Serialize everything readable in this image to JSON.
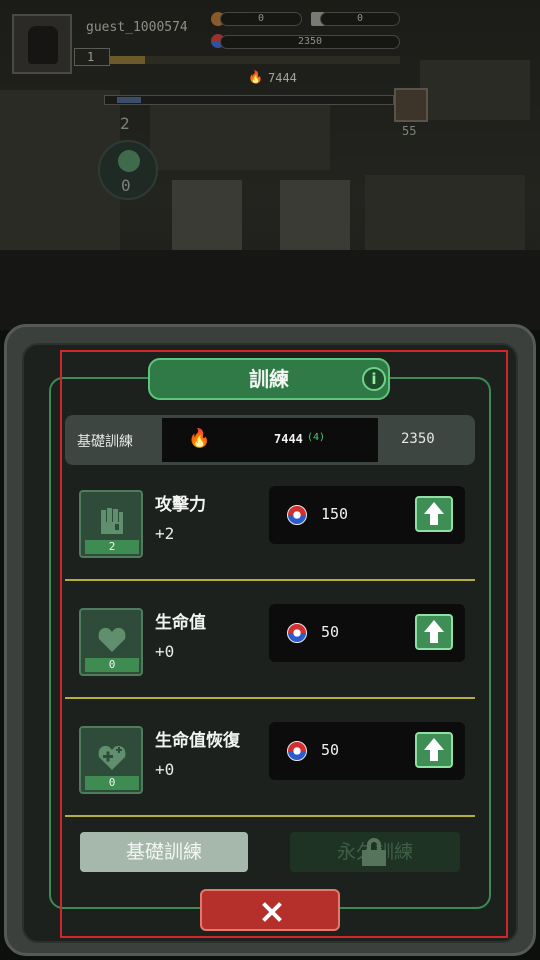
{
  "hud": {
    "player_name": "guest_1000574",
    "player_level": "1",
    "resource_a": "0",
    "resource_b": "0",
    "gold": "2350",
    "fire_power": "7444",
    "stage": "2",
    "kills": "0",
    "boss_count": "55",
    "xp_progress": 0.12
  },
  "panel": {
    "title": "訓練",
    "info_icon": "info-icon",
    "summary": {
      "label": "基礎訓練",
      "fire_value": "7444",
      "fire_delta": "(4)",
      "gold": "2350"
    },
    "stats": [
      {
        "name": "攻擊力",
        "bonus": "+2",
        "level": "2",
        "cost": "150",
        "icon": "fist-icon"
      },
      {
        "name": "生命值",
        "bonus": "+0",
        "level": "0",
        "cost": "50",
        "icon": "heart-icon"
      },
      {
        "name": "生命值恢復",
        "bonus": "+0",
        "level": "0",
        "cost": "50",
        "icon": "heart-plus-icon"
      }
    ],
    "tabs": {
      "basic": "基礎訓練",
      "permanent": "永久訓練"
    },
    "close_icon": "close-icon"
  },
  "colors": {
    "accent_green": "#3e8e55",
    "close_red": "#b5302b",
    "divider_yellow": "#b6ae3b"
  }
}
